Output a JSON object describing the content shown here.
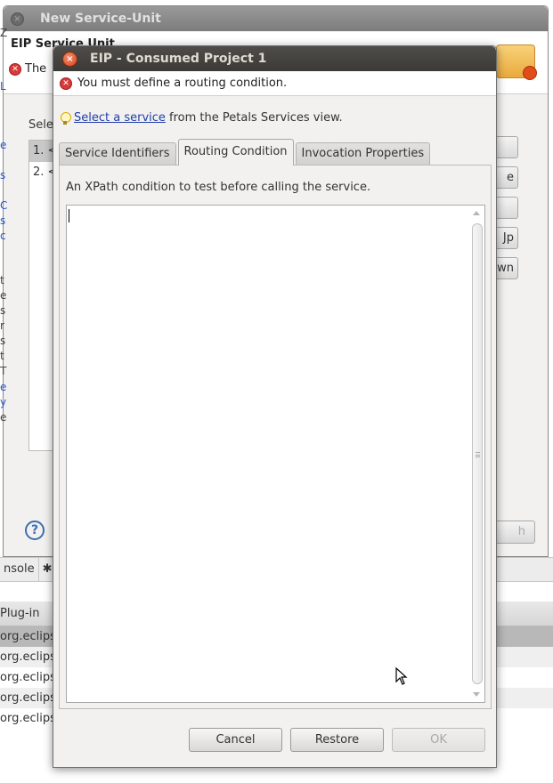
{
  "background": {
    "window_title": "New Service-Unit",
    "header_title": "EIP Service Unit",
    "header_error": "The",
    "select_label": "Selec",
    "list_items": [
      "1. <",
      "2. <"
    ],
    "side_buttons": [
      "",
      "e",
      "",
      "Jp",
      "own"
    ],
    "finish_label": "h",
    "help_label": "?",
    "console_tabs": [
      "nsole",
      "✱"
    ],
    "table": {
      "header": "Plug-in",
      "rows": [
        "org.eclips",
        "org.eclips",
        "org.eclips",
        "org.eclips",
        "org.eclips"
      ]
    },
    "left_fragments": [
      {
        "text": "Z",
        "color": "dark"
      },
      {
        "text": "L",
        "color": "blue"
      },
      {
        "text": "e",
        "color": "blue"
      },
      {
        "text": "s",
        "color": "blue"
      },
      {
        "text": "C",
        "color": "blue"
      },
      {
        "text": "s",
        "color": "blue"
      },
      {
        "text": "c",
        "color": "blue"
      },
      {
        "text": "t",
        "color": "dark"
      },
      {
        "text": "e",
        "color": "dark"
      },
      {
        "text": "s",
        "color": "dark"
      },
      {
        "text": "r",
        "color": "dark"
      },
      {
        "text": "s",
        "color": "dark"
      },
      {
        "text": "t",
        "color": "dark"
      },
      {
        "text": "T",
        "color": "dark"
      },
      {
        "text": "e",
        "color": "blue"
      },
      {
        "text": "y",
        "color": "blue"
      },
      {
        "text": "e",
        "color": "dark"
      }
    ]
  },
  "dialog": {
    "title": "EIP - Consumed Project 1",
    "error_message": "You must define a routing condition.",
    "hint_link": "Select a service",
    "hint_rest": " from the Petals Services view.",
    "tabs": [
      {
        "label": "Service Identifiers",
        "active": false
      },
      {
        "label": "Routing Condition",
        "active": true
      },
      {
        "label": "Invocation Properties",
        "active": false
      }
    ],
    "panel_description": "An XPath condition to test before calling the service.",
    "condition_value": "",
    "buttons": {
      "cancel": "Cancel",
      "restore": "Restore",
      "ok": "OK"
    }
  },
  "colors": {
    "dialog_title_bg": "#3b3a37",
    "close_button": "#d8471d",
    "error_icon": "#d83a3a",
    "link": "#1f3fa8",
    "selected_row": "#b8b8b8"
  }
}
